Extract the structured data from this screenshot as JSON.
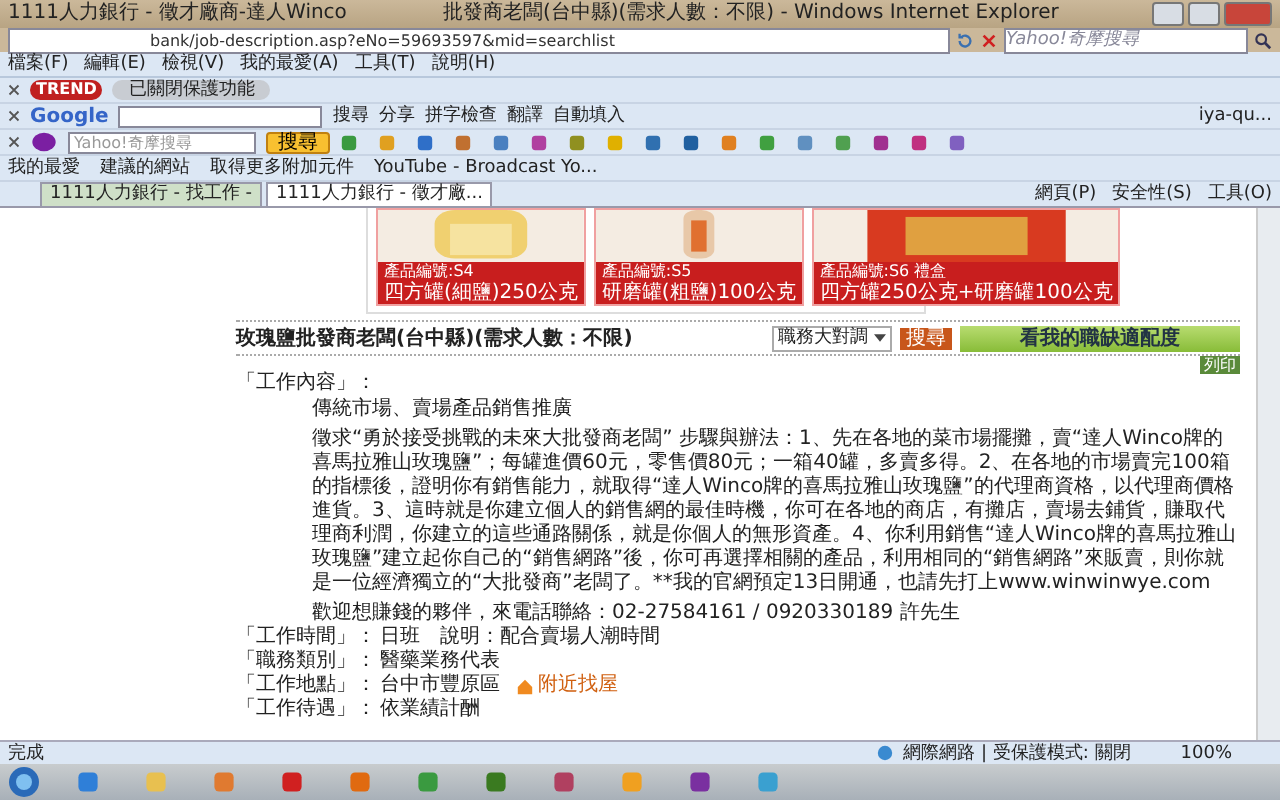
{
  "window": {
    "title_left": "1111人力銀行 - 徵才廠商-達人Winco",
    "title_right": "批發商老闆(台中縣)(需求人數：不限) - Windows Internet Explorer"
  },
  "address_bar": {
    "url": "bank/job-description.asp?eNo=59693597&mid=searchlist",
    "search_placeholder": "Yahoo!奇摩搜尋"
  },
  "menu": [
    "檔案(F)",
    "編輯(E)",
    "檢視(V)",
    "我的最愛(A)",
    "工具(T)",
    "說明(H)"
  ],
  "trend_toolbar": {
    "logo": "TREND",
    "status": "已關閉保護功能"
  },
  "google_toolbar": {
    "logo": "Google",
    "buttons": [
      "搜尋",
      "分享",
      "拼字檢查",
      "翻譯",
      "自動填入"
    ],
    "account": "iya-qu..."
  },
  "yahoo_toolbar": {
    "placeholder": "Yahoo!奇摩搜尋",
    "search_button": "搜尋"
  },
  "favorites_bar": {
    "items": [
      "我的最愛",
      "建議的網站",
      "取得更多附加元件",
      "YouTube - Broadcast Yo..."
    ]
  },
  "tabs": [
    {
      "label": "1111人力銀行 - 找工作 -",
      "selected": false
    },
    {
      "label": "1111人力銀行 - 徵才廠...",
      "selected": true
    }
  ],
  "command_bar": [
    "網頁(P)",
    "安全性(S)",
    "工具(O)"
  ],
  "products": [
    {
      "code": "產品編號:S4",
      "name": "四方罐(細鹽)250公克"
    },
    {
      "code": "產品編號:S5",
      "name": "研磨罐(粗鹽)100公克"
    },
    {
      "code": "產品編號:S6 禮盒",
      "name": "四方罐250公克+研磨罐100公克"
    }
  ],
  "job": {
    "title": "玫瑰鹽批發商老闆(台中縣)(需求人數：不限)",
    "dropdown": "職務大對調",
    "search_button": "搜尋",
    "match_button": "看我的職缺適配度",
    "print_button": "列印",
    "section_label": "「工作內容」：",
    "summary": "傳統市場、賣場產品銷售推廣",
    "description": "徵求“勇於接受挑戰的未來大批發商老闆” 步驟與辦法：1、先在各地的菜市場擺攤，賣“達人Winco牌的喜馬拉雅山玫瑰鹽”；每罐進價60元，零售價80元；一箱40罐，多賣多得。2、在各地的市場賣完100箱的指標後，證明你有銷售能力，就取得“達人Winco牌的喜馬拉雅山玫瑰鹽”的代理商資格，以代理商價格進貨。3、這時就是你建立個人的銷售網的最佳時機，你可在各地的商店，有攤店，賣場去鋪貨，賺取代理商利潤，你建立的這些通路關係，就是你個人的無形資產。4、你利用銷售“達人Winco牌的喜馬拉雅山玫瑰鹽”建立起你自己的“銷售網路”後，你可再選擇相關的產品，利用相同的“銷售網路”來販賣，則你就是一位經濟獨立的“大批發商”老闆了。**我的官網預定13日開通，也請先打上www.winwinwye.com",
    "contact": "歡迎想賺錢的夥伴，來電話聯絡：02-27584161 / 0920330189 許先生",
    "fields": [
      {
        "label": "「工作時間」：",
        "value": "日班　說明：配合賣場人潮時間"
      },
      {
        "label": "「職務類別」：",
        "value": "醫藥業務代表"
      },
      {
        "label": "「工作地點」：",
        "value": "台中市豐原區",
        "link": "附近找屋"
      },
      {
        "label": "「工作待遇」：",
        "value": "依業績計酬"
      }
    ]
  },
  "status_bar": {
    "text": "完成",
    "zone": "網際網路 | 受保護模式: 關閉",
    "zoom": "100%"
  }
}
